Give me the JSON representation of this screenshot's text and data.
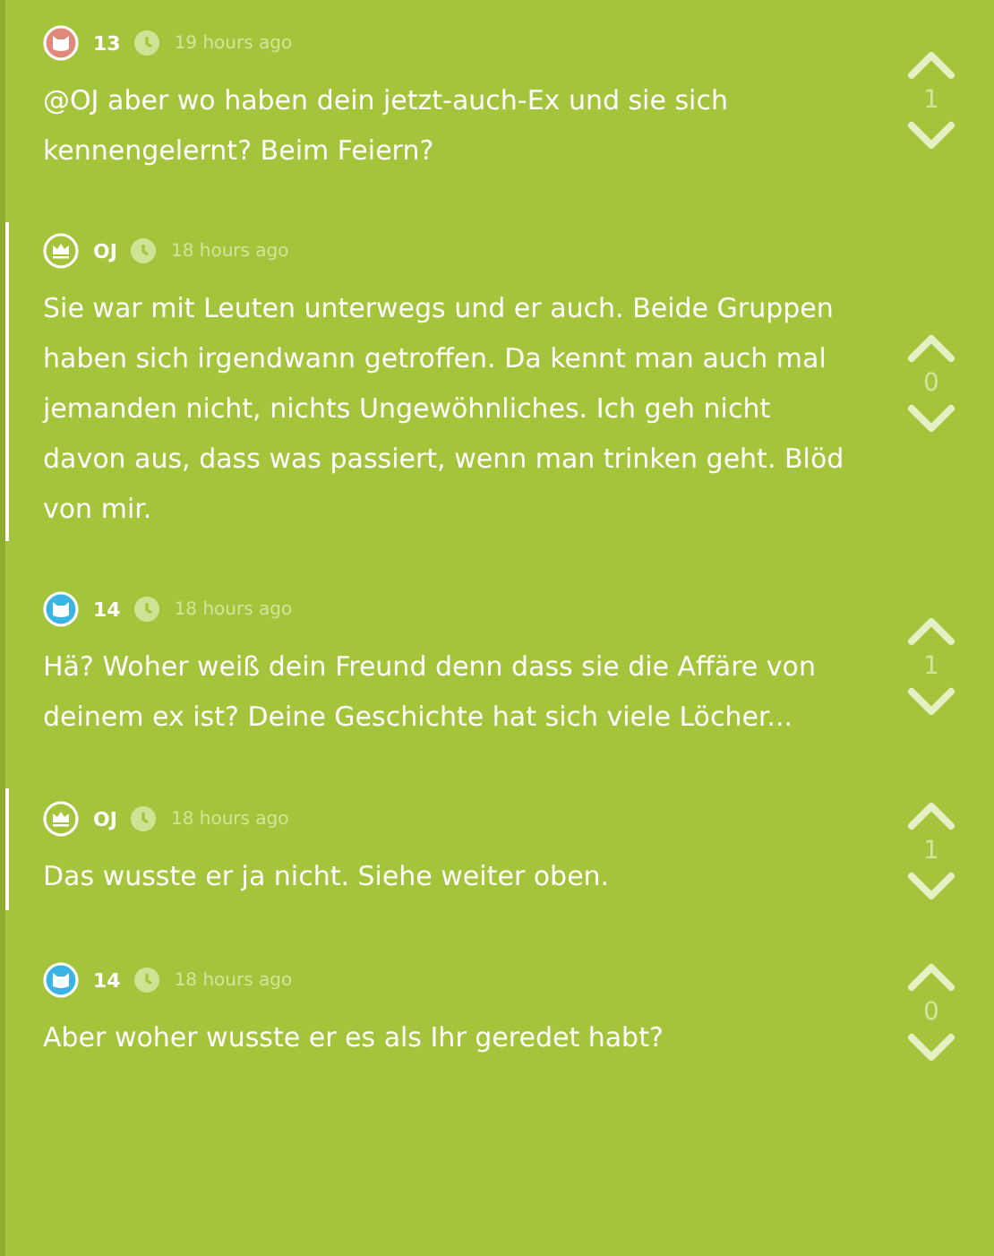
{
  "comments": [
    {
      "author": "13",
      "avatar": {
        "kind": "cat",
        "color": "#e0887a"
      },
      "is_op": false,
      "time": "19 hours ago",
      "text": "@OJ aber wo haben dein jetzt-auch-Ex und sie sich kennengelernt? Beim Feiern?",
      "votes": "1"
    },
    {
      "author": "OJ",
      "avatar": {
        "kind": "crown"
      },
      "is_op": true,
      "time": "18 hours ago",
      "text": "Sie war mit Leuten unterwegs und er auch. Beide Gruppen haben sich irgendwann getroffen. Da kennt man auch mal jemanden nicht, nichts Ungewöhnliches. Ich geh nicht davon aus, dass was passiert, wenn man trinken geht. Blöd von mir.",
      "votes": "0"
    },
    {
      "author": "14",
      "avatar": {
        "kind": "cat",
        "color": "#3ab4e2"
      },
      "is_op": false,
      "time": "18 hours ago",
      "text": "Hä? Woher weiß dein Freund denn dass sie die Affäre von deinem ex ist? Deine Geschichte hat sich viele Löcher...",
      "votes": "1"
    },
    {
      "author": "OJ",
      "avatar": {
        "kind": "crown"
      },
      "is_op": true,
      "time": "18 hours ago",
      "text": "Das wusste er ja nicht. Siehe weiter oben.",
      "votes": "1"
    },
    {
      "author": "14",
      "avatar": {
        "kind": "cat",
        "color": "#3ab4e2"
      },
      "is_op": false,
      "time": "18 hours ago",
      "text": "Aber woher wusste er es als Ihr geredet habt?",
      "votes": "0"
    }
  ]
}
